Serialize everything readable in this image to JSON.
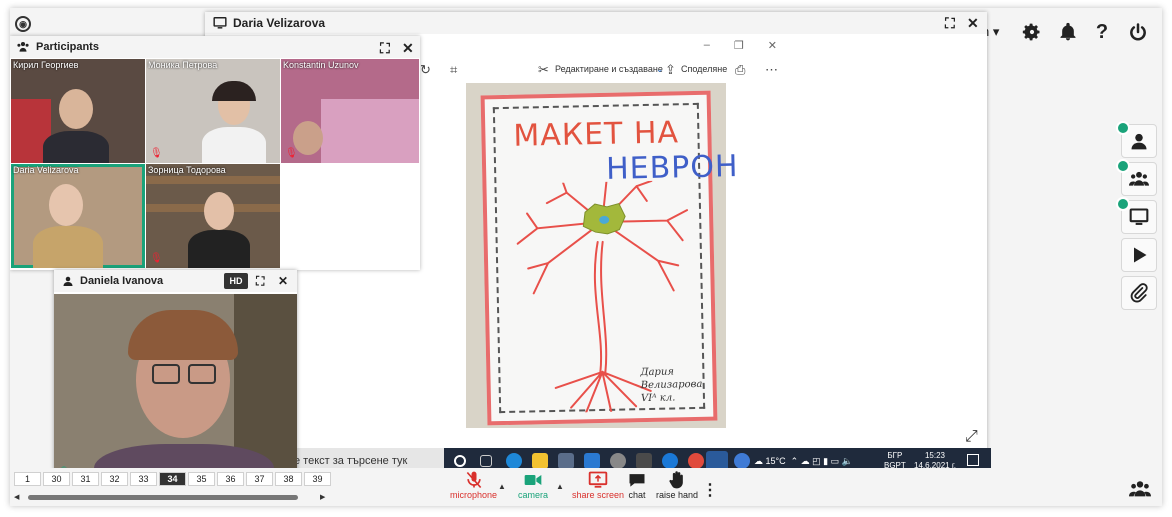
{
  "user_menu": {
    "label": "n ▾"
  },
  "share_window": {
    "title": "Daria Velizarova",
    "photo_toolbar": {
      "edit_label": "Редактиране и създаване",
      "share_label": "Споделяне"
    },
    "poster": {
      "title_line1": "МАКЕТ НА",
      "title_line2": "НЕВРОН",
      "signature_line1": "Дария",
      "signature_line2": "Велизарова VIᴬ кл."
    },
    "search_placeholder": "е текст за търсене тук",
    "taskbar": {
      "weather": "15°C",
      "lang_line1": "БГР",
      "lang_line2": "BGPT",
      "time": "15:23",
      "date": "14.6.2021 г."
    }
  },
  "participants": {
    "title": "Participants",
    "tiles": [
      {
        "name": "Кирил Георгиев"
      },
      {
        "name": "Моника Петрова"
      },
      {
        "name": "Konstantin Uzunov"
      },
      {
        "name": "Daria Velizarova"
      },
      {
        "name": "Зорница Тодорова"
      }
    ]
  },
  "speaker": {
    "name": "Daniela Ivanova",
    "hd_label": "HD"
  },
  "pagination": {
    "pages": [
      "1",
      "30",
      "31",
      "32",
      "33",
      "34",
      "35",
      "36",
      "37",
      "38",
      "39"
    ],
    "current": "34"
  },
  "controls": {
    "microphone": "microphone",
    "camera": "camera",
    "share_screen": "share screen",
    "chat": "chat",
    "raise_hand": "raise hand"
  },
  "colors": {
    "accent_green": "#1aa37a",
    "alert_red": "#d9302c",
    "poster_red": "#e2533f",
    "poster_blue": "#3f5fc8"
  }
}
